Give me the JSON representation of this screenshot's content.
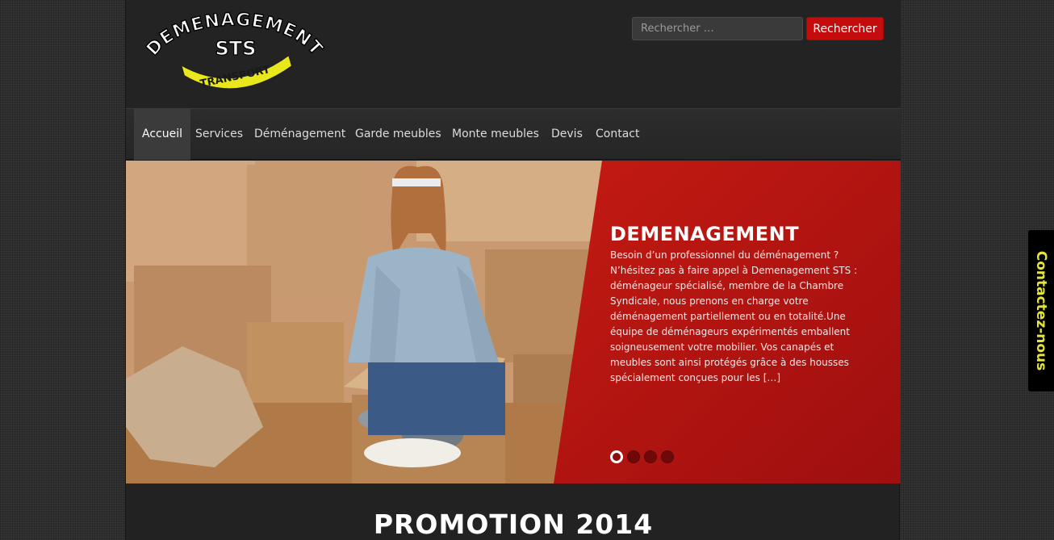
{
  "logo": {
    "arc_text": "DEMENAGEMENT",
    "mark": "STS",
    "banner": "TRANSPORT"
  },
  "search": {
    "placeholder": "Rechercher …",
    "value": "",
    "button_label": "Rechercher"
  },
  "nav": {
    "items": [
      {
        "label": "Accueil",
        "active": true
      },
      {
        "label": "Services"
      },
      {
        "label": "Déménagement"
      },
      {
        "label": "Garde meubles"
      },
      {
        "label": "Monte meubles"
      },
      {
        "label": "Devis"
      },
      {
        "label": "Contact"
      }
    ]
  },
  "slider": {
    "title": "DEMENAGEMENT",
    "text": "Besoin d’un professionnel du déménagement ? N’hésitez pas à faire appel à Demenagement STS : déménageur spécialisé, membre de la Chambre Syndicale, nous prenons en charge votre déménagement partiellement ou en totalité.Une équipe de déménageurs expérimentés emballent soigneusement votre mobilier. Vos canapés et meubles sont ainsi protégés grâce à des housses spécialement conçues pour les […]",
    "slide_count": 4,
    "active_slide": 1
  },
  "promo": {
    "title": "PROMOTION 2014"
  },
  "contact_tab": {
    "label": "Contactez-nous"
  },
  "colors": {
    "accent_red": "#c40c0c",
    "slide_red": "#b01210",
    "contact_text": "#e6e43a",
    "logo_yellow": "#e8e81c"
  }
}
